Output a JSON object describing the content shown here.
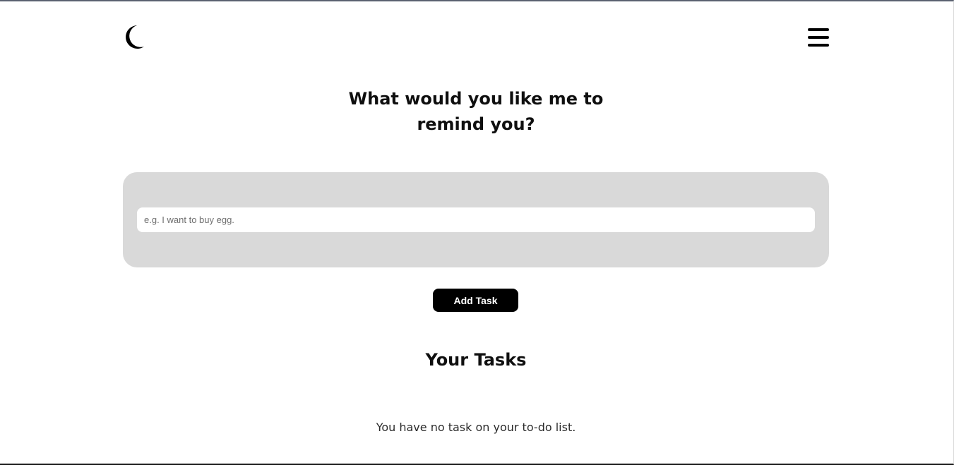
{
  "header": {
    "theme_toggle_icon": "moon-icon",
    "menu_icon": "hamburger-menu-icon"
  },
  "prompt": {
    "title_line1": "What would you like me to",
    "title_line2": "remind you?"
  },
  "task_form": {
    "input_value": "",
    "input_placeholder": "e.g. I want to buy egg.",
    "add_button_label": "Add Task"
  },
  "tasks": {
    "heading": "Your Tasks",
    "items": [],
    "empty_message": "You have no task on your to-do list."
  },
  "colors": {
    "panel_background": "#d9d9d9",
    "button_background": "#000000",
    "button_text": "#ffffff",
    "page_background": "#ffffff"
  }
}
